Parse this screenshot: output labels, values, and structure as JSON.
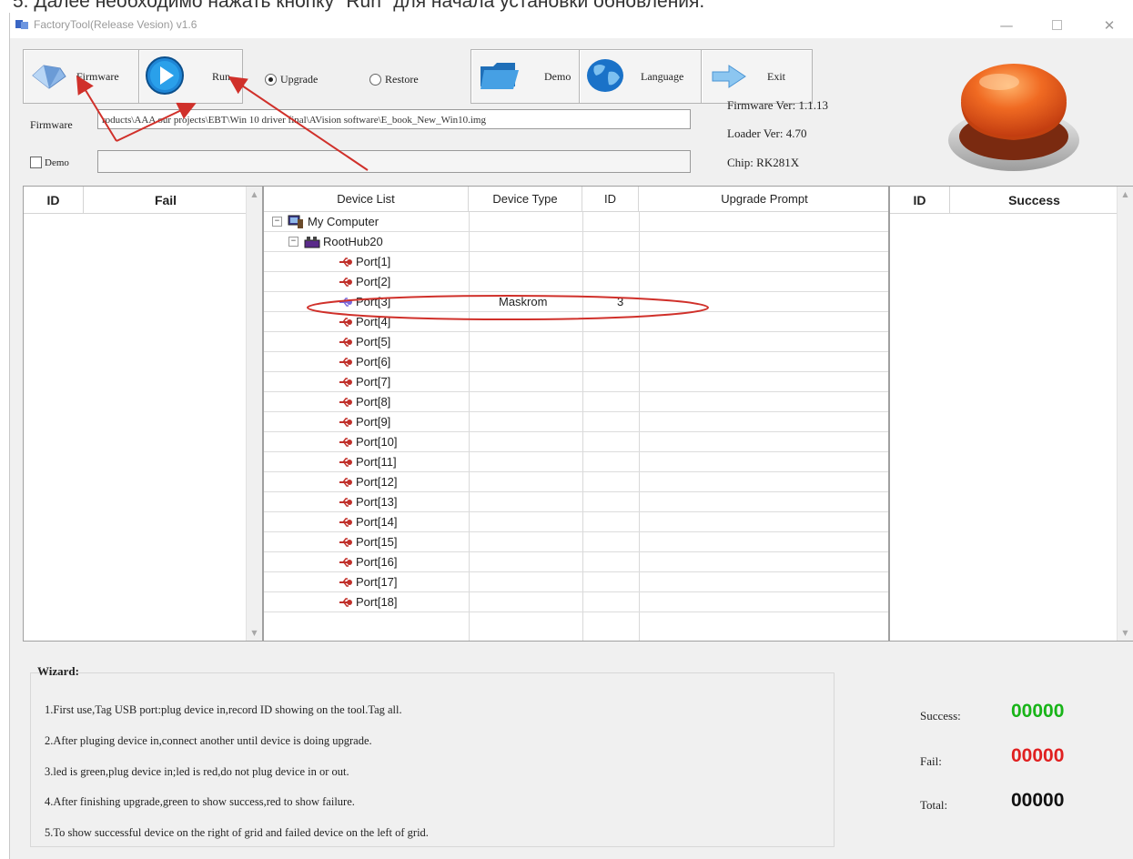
{
  "doc_text": "5. Далее необходимо нажать кнопку \"Run\" для начала установки обновления.",
  "window": {
    "title": "FactoryTool(Release Vesion) v1.6"
  },
  "toolbar": {
    "firmware_label": "Firmware",
    "run_label": "Run",
    "upgrade_label": "Upgrade",
    "restore_label": "Restore",
    "demo_label": "Demo",
    "language_label": "Language",
    "exit_label": "Exit",
    "selected_mode": "Upgrade"
  },
  "firmware": {
    "label": "Firmware",
    "path": "roducts\\AAA our projects\\EBT\\Win 10 driver final\\AVision software\\E_book_New_Win10.img"
  },
  "demo": {
    "checkbox_label": "Demo",
    "path": ""
  },
  "info": {
    "firmware_ver": "Firmware Ver: 1.1.13",
    "loader_ver": "Loader Ver: 4.70",
    "chip": "Chip: RK281X"
  },
  "fail_panel": {
    "col_id": "ID",
    "col_status": "Fail"
  },
  "success_panel": {
    "col_id": "ID",
    "col_status": "Success"
  },
  "device_table": {
    "headers": [
      "Device List",
      "Device Type",
      "ID",
      "Upgrade Prompt"
    ],
    "root": "My Computer",
    "hub": "RootHub20",
    "ports": [
      {
        "name": "Port[1]",
        "type": "",
        "id": ""
      },
      {
        "name": "Port[2]",
        "type": "",
        "id": ""
      },
      {
        "name": "Port[3]",
        "type": "Maskrom",
        "id": "3"
      },
      {
        "name": "Port[4]",
        "type": "",
        "id": ""
      },
      {
        "name": "Port[5]",
        "type": "",
        "id": ""
      },
      {
        "name": "Port[6]",
        "type": "",
        "id": ""
      },
      {
        "name": "Port[7]",
        "type": "",
        "id": ""
      },
      {
        "name": "Port[8]",
        "type": "",
        "id": ""
      },
      {
        "name": "Port[9]",
        "type": "",
        "id": ""
      },
      {
        "name": "Port[10]",
        "type": "",
        "id": ""
      },
      {
        "name": "Port[11]",
        "type": "",
        "id": ""
      },
      {
        "name": "Port[12]",
        "type": "",
        "id": ""
      },
      {
        "name": "Port[13]",
        "type": "",
        "id": ""
      },
      {
        "name": "Port[14]",
        "type": "",
        "id": ""
      },
      {
        "name": "Port[15]",
        "type": "",
        "id": ""
      },
      {
        "name": "Port[16]",
        "type": "",
        "id": ""
      },
      {
        "name": "Port[17]",
        "type": "",
        "id": ""
      },
      {
        "name": "Port[18]",
        "type": "",
        "id": ""
      }
    ]
  },
  "wizard": {
    "title": "Wizard:",
    "lines": [
      "1.First use,Tag USB port:plug device in,record ID showing on the tool.Tag all.",
      "2.After pluging device in,connect another until device is doing upgrade.",
      "3.led is green,plug device in;led is red,do not plug device in or out.",
      "4.After finishing upgrade,green to show success,red to show failure.",
      "5.To show successful device on the right of grid and failed device on the left of grid."
    ]
  },
  "stats": {
    "success_label": "Success:",
    "success_value": "00000",
    "fail_label": "Fail:",
    "fail_value": "00000",
    "total_label": "Total:",
    "total_value": "00000"
  },
  "colors": {
    "success": "#18b418",
    "fail": "#e02020",
    "annotation": "#d0302a",
    "big_button": "#e85a1c"
  },
  "icons": {
    "firmware": "gem-icon",
    "run": "play-icon",
    "demo": "folder-icon",
    "language": "globe-icon",
    "exit": "arrow-right-icon",
    "big_button": "red-push-button",
    "port": "usb-icon"
  }
}
